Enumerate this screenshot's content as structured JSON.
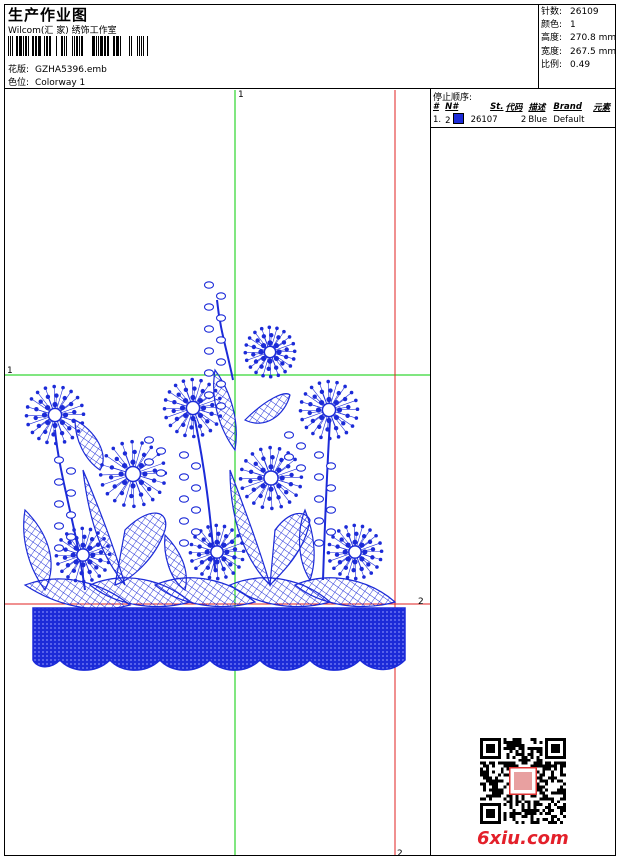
{
  "header": {
    "title": "生产作业图",
    "company": "Wilcom(汇 家) 绣饰工作室",
    "design_label": "花版:",
    "design_file": "GZHA5396.emb",
    "colorway_label": "色位:",
    "colorway": "Colorway 1"
  },
  "stats": [
    {
      "label": "针数:",
      "value": "26109"
    },
    {
      "label": "颜色:",
      "value": "1"
    },
    {
      "label": "高度:",
      "value": "270.8 mm"
    },
    {
      "label": "宽度:",
      "value": "267.5 mm"
    },
    {
      "label": "比例:",
      "value": "0.49"
    }
  ],
  "stop_sequence": {
    "title": "停止顺序:",
    "headers": [
      "#",
      "N#",
      "St.",
      "代码",
      "描述",
      "Brand",
      "元素"
    ],
    "rows": [
      {
        "index": "1.",
        "needle": "2",
        "stitches": "26107",
        "code": "2",
        "description": "Blue",
        "brand": "Default",
        "color": "#1c2bd8"
      }
    ]
  },
  "guides": {
    "green_top": "1",
    "green_left": "1",
    "red_right": "2",
    "red_bottom": "2"
  },
  "watermark": {
    "logo_text": "6xiu.com"
  },
  "colors": {
    "thread_blue": "#1c2bd8",
    "guide_green": "#00cc00",
    "guide_red": "#e02020",
    "logo_red": "#e3202a"
  }
}
